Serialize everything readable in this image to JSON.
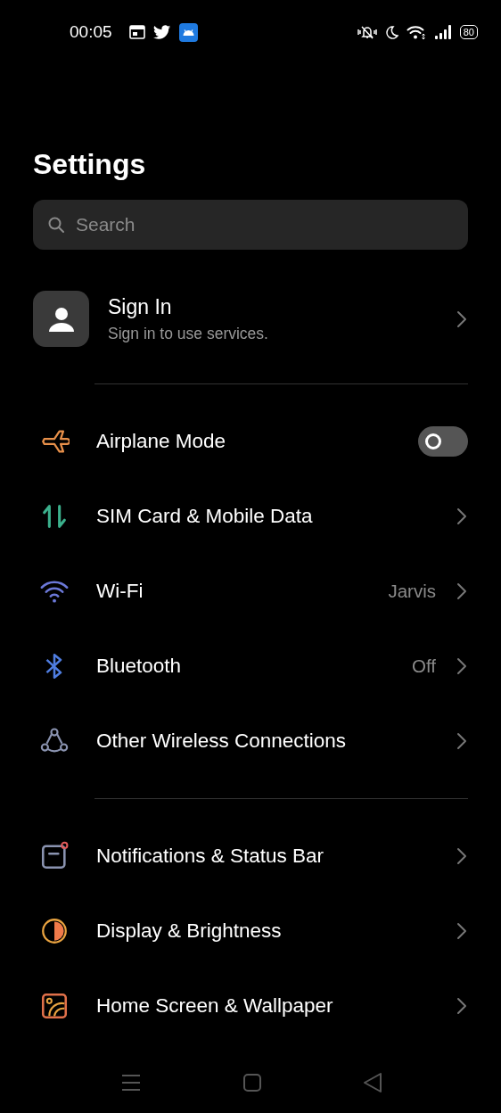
{
  "status_bar": {
    "time": "00:05",
    "battery": "80"
  },
  "title": "Settings",
  "search": {
    "placeholder": "Search"
  },
  "account": {
    "title": "Sign In",
    "subtitle": "Sign in to use services."
  },
  "groups": [
    {
      "items": [
        {
          "kind": "toggle",
          "label": "Airplane Mode",
          "on": false
        },
        {
          "kind": "link",
          "label": "SIM Card & Mobile Data"
        },
        {
          "kind": "link",
          "label": "Wi-Fi",
          "value": "Jarvis"
        },
        {
          "kind": "link",
          "label": "Bluetooth",
          "value": "Off"
        },
        {
          "kind": "link",
          "label": "Other Wireless Connections"
        }
      ]
    },
    {
      "items": [
        {
          "kind": "link",
          "label": "Notifications & Status Bar"
        },
        {
          "kind": "link",
          "label": "Display & Brightness"
        },
        {
          "kind": "link",
          "label": "Home Screen & Wallpaper"
        }
      ]
    }
  ]
}
